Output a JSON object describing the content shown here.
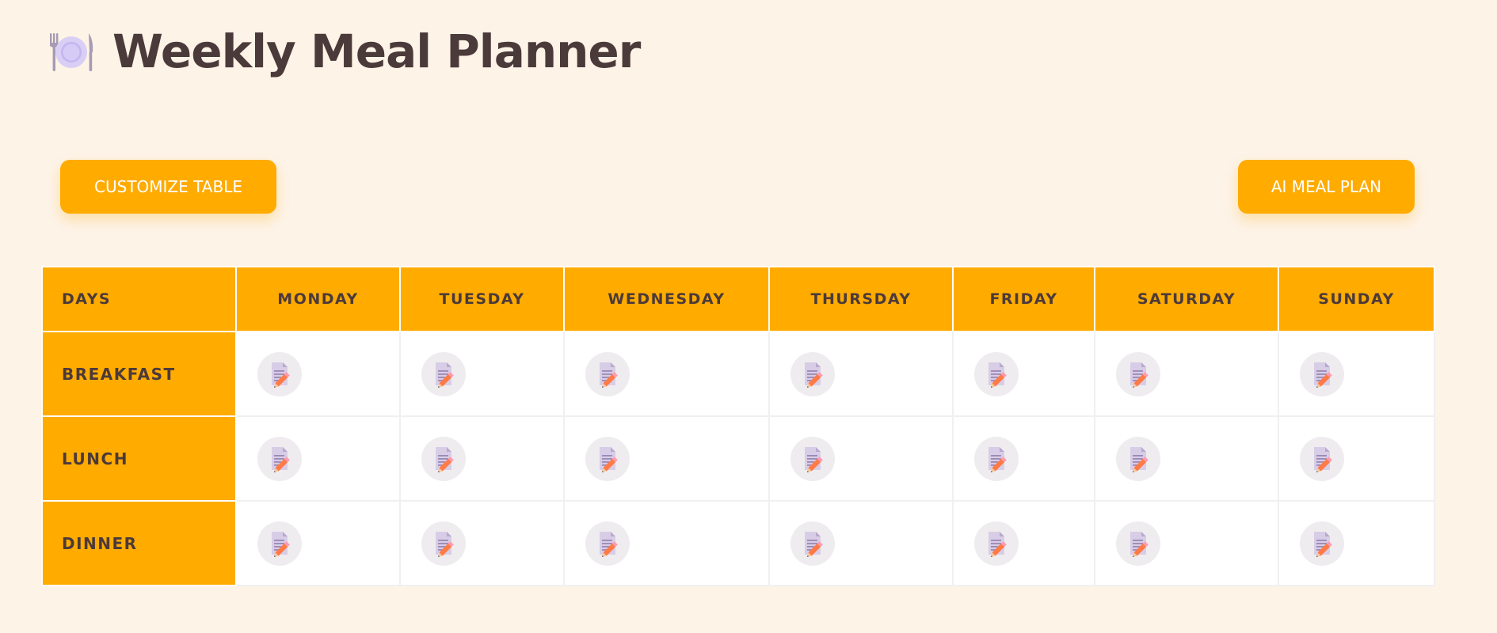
{
  "header": {
    "title": "Weekly Meal Planner",
    "icon": "plate-cutlery-icon"
  },
  "toolbar": {
    "customize_label": "CUSTOMIZE TABLE",
    "ai_label": "AI MEAL PLAN"
  },
  "table": {
    "corner_label": "DAYS",
    "days": [
      "MONDAY",
      "TUESDAY",
      "WEDNESDAY",
      "THURSDAY",
      "FRIDAY",
      "SATURDAY",
      "SUNDAY"
    ],
    "meals": [
      "BREAKFAST",
      "LUNCH",
      "DINNER"
    ],
    "cell_icon": "memo-edit-icon"
  },
  "colors": {
    "background": "#fdf3e7",
    "accent": "#ffab00",
    "text": "#4b3a3a",
    "icon_bg": "#efecef"
  }
}
